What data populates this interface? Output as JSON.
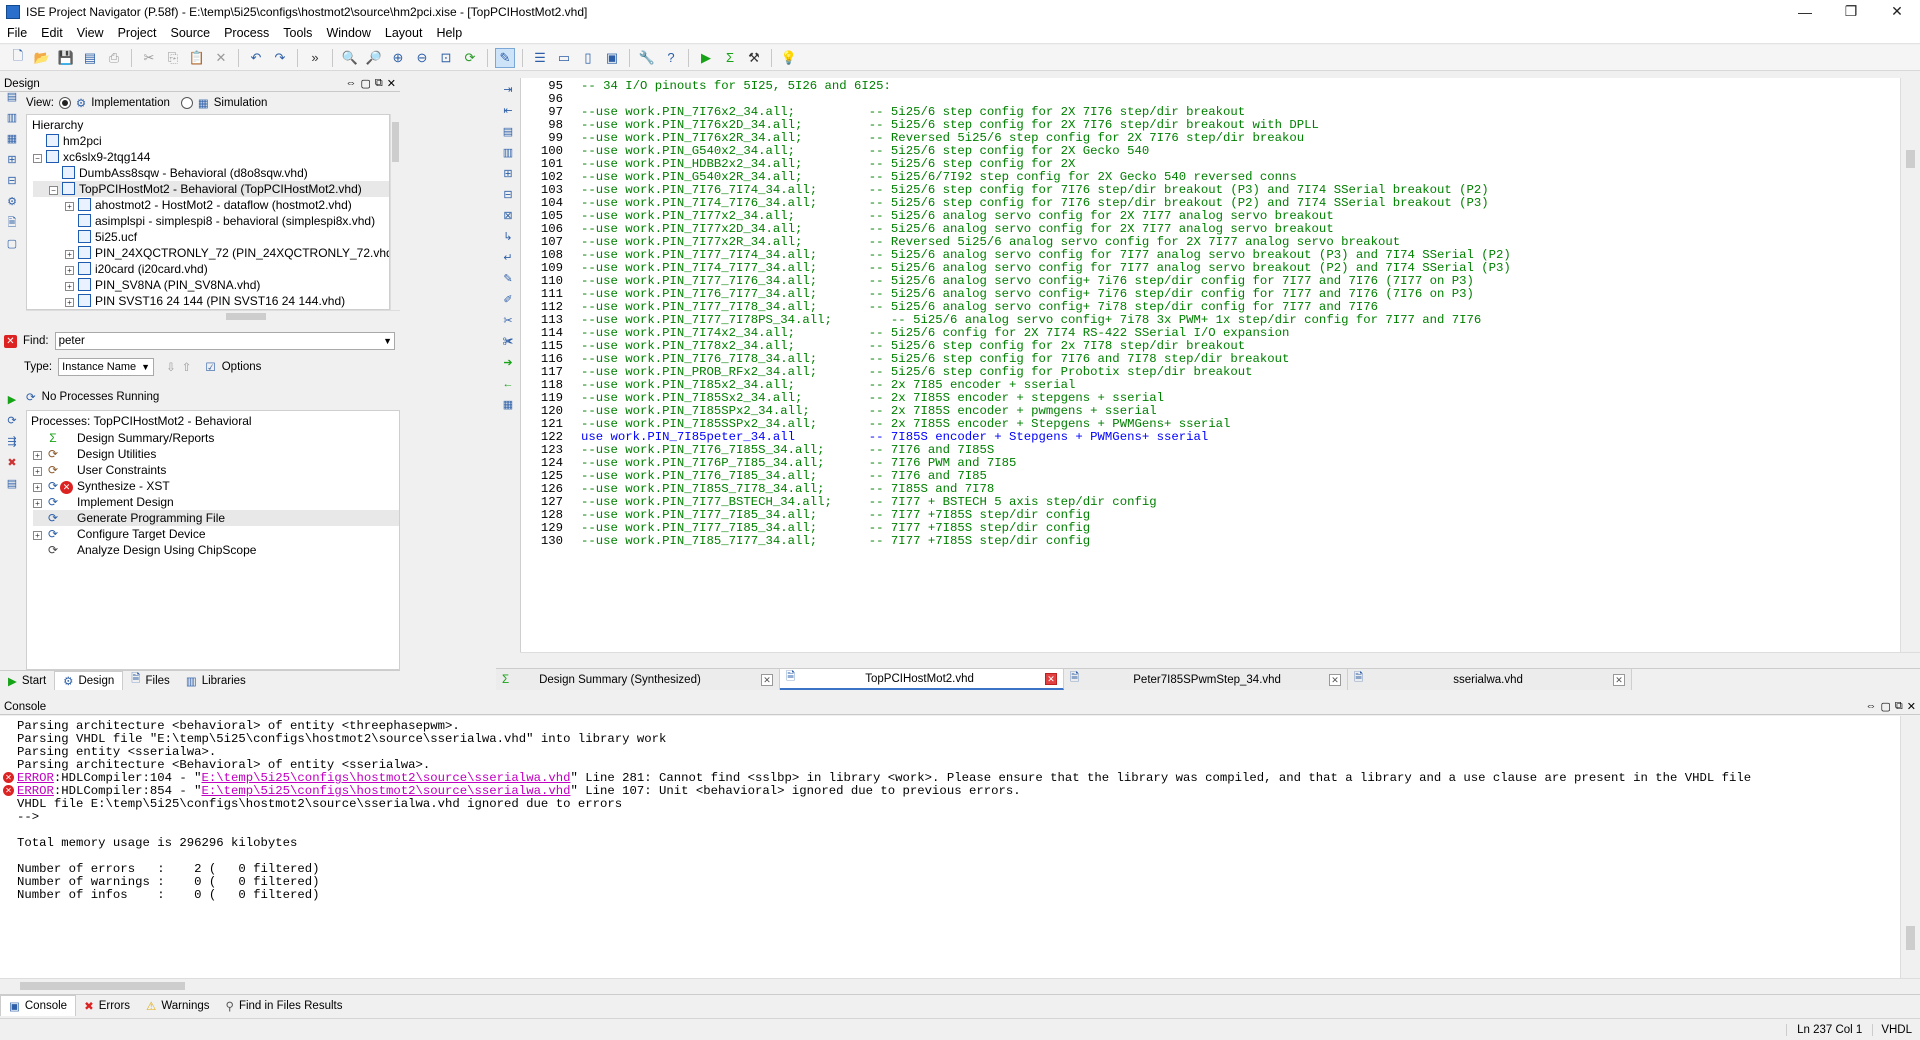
{
  "window": {
    "title": "ISE Project Navigator (P.58f) - E:\\temp\\5i25\\configs\\hostmot2\\source\\hm2pci.xise - [TopPCIHostMot2.vhd]"
  },
  "menu": [
    "File",
    "Edit",
    "View",
    "Project",
    "Source",
    "Process",
    "Tools",
    "Window",
    "Layout",
    "Help"
  ],
  "design_panel": {
    "title": "Design",
    "view_label": "View:",
    "radio_impl": "Implementation",
    "radio_sim": "Simulation",
    "hierarchy_label": "Hierarchy",
    "tree": [
      {
        "label": "hm2pci",
        "indent": 0,
        "exp": ""
      },
      {
        "label": "xc6slx9-2tqg144",
        "indent": 0,
        "exp": "−"
      },
      {
        "label": "DumbAss8sqw - Behavioral (d8o8sqw.vhd)",
        "indent": 1,
        "exp": ""
      },
      {
        "label": "TopPCIHostMot2 - Behavioral (TopPCIHostMot2.vhd)",
        "indent": 1,
        "exp": "−"
      },
      {
        "label": "ahostmot2 - HostMot2 - dataflow (hostmot2.vhd)",
        "indent": 2,
        "exp": "+"
      },
      {
        "label": "asimplspi - simplespi8 - behavioral (simplespi8x.vhd)",
        "indent": 2,
        "exp": ""
      },
      {
        "label": "5i25.ucf",
        "indent": 2,
        "exp": ""
      },
      {
        "label": "PIN_24XQCTRONLY_72 (PIN_24XQCTRONLY_72.vhd)",
        "indent": 2,
        "exp": "+"
      },
      {
        "label": "i20card (i20card.vhd)",
        "indent": 2,
        "exp": "+"
      },
      {
        "label": "PIN_SV8NA (PIN_SV8NA.vhd)",
        "indent": 2,
        "exp": "+"
      },
      {
        "label": "PIN SVST16 24 144 (PIN SVST16 24 144.vhd)",
        "indent": 2,
        "exp": "+"
      }
    ],
    "find_label": "Find:",
    "find_value": "peter",
    "type_label": "Type:",
    "type_value": "Instance Name",
    "options_label": "Options"
  },
  "processes": {
    "status": "No Processes Running",
    "header": "Processes: TopPCIHostMot2 - Behavioral",
    "items": [
      {
        "label": "Design Summary/Reports",
        "exp": ""
      },
      {
        "label": "Design Utilities",
        "exp": "+"
      },
      {
        "label": "User Constraints",
        "exp": "+"
      },
      {
        "label": "Synthesize - XST",
        "exp": "+"
      },
      {
        "label": "Implement Design",
        "exp": "+"
      },
      {
        "label": "Generate Programming File",
        "exp": ""
      },
      {
        "label": "Configure Target Device",
        "exp": "+"
      },
      {
        "label": "Analyze Design Using ChipScope",
        "exp": ""
      }
    ]
  },
  "left_tabs": [
    "Start",
    "Design",
    "Files",
    "Libraries"
  ],
  "editor": {
    "lines": [
      {
        "n": "95",
        "t": "-- 34 I/O pinouts for 5I25, 5I26 and 6I25:"
      },
      {
        "n": "96",
        "t": ""
      },
      {
        "n": "97",
        "t": "--use work.PIN_7I76x2_34.all;          -- 5i25/6 step config for 2X 7I76 step/dir breakout"
      },
      {
        "n": "98",
        "t": "--use work.PIN_7I76x2D_34.all;         -- 5i25/6 step config for 2X 7I76 step/dir breakout with DPLL"
      },
      {
        "n": "99",
        "t": "--use work.PIN_7I76x2R_34.all;         -- Reversed 5i25/6 step config for 2X 7I76 step/dir breakou"
      },
      {
        "n": "100",
        "t": "--use work.PIN_G540x2_34.all;          -- 5i25/6 step config for 2X Gecko 540"
      },
      {
        "n": "101",
        "t": "--use work.PIN_HDBB2x2_34.all;         -- 5i25/6 step config for 2X"
      },
      {
        "n": "102",
        "t": "--use work.PIN_G540x2R_34.all;         -- 5i25/6/7I92 step config for 2X Gecko 540 reversed conns"
      },
      {
        "n": "103",
        "t": "--use work.PIN_7I76_7I74_34.all;       -- 5i25/6 step config for 7I76 step/dir breakout (P3) and 7I74 SSerial breakout (P2)"
      },
      {
        "n": "104",
        "t": "--use work.PIN_7I74_7I76_34.all;       -- 5i25/6 step config for 7I76 step/dir breakout (P2) and 7I74 SSerial breakout (P3)"
      },
      {
        "n": "105",
        "t": "--use work.PIN_7I77x2_34.all;          -- 5i25/6 analog servo config for 2X 7I77 analog servo breakout"
      },
      {
        "n": "106",
        "t": "--use work.PIN_7I77x2D_34.all;         -- 5i25/6 analog servo config for 2X 7I77 analog servo breakout"
      },
      {
        "n": "107",
        "t": "--use work.PIN_7I77x2R_34.all;         -- Reversed 5i25/6 analog servo config for 2X 7I77 analog servo breakout"
      },
      {
        "n": "108",
        "t": "--use work.PIN_7I77_7I74_34.all;       -- 5i25/6 analog servo config for 7I77 analog servo breakout (P3) and 7I74 SSerial (P2)"
      },
      {
        "n": "109",
        "t": "--use work.PIN_7I74_7I77_34.all;       -- 5i25/6 analog servo config for 7I77 analog servo breakout (P2) and 7I74 SSerial (P3)"
      },
      {
        "n": "110",
        "t": "--use work.PIN_7I77_7I76_34.all;       -- 5i25/6 analog servo config+ 7i76 step/dir config for 7I77 and 7I76 (7I77 on P3)"
      },
      {
        "n": "111",
        "t": "--use work.PIN_7I76_7I77_34.all;       -- 5i25/6 analog servo config+ 7i76 step/dir config for 7I77 and 7I76 (7I76 on P3)"
      },
      {
        "n": "112",
        "t": "--use work.PIN_7I77_7I78_34.all;       -- 5i25/6 analog servo config+ 7i78 step/dir config for 7I77 and 7I76"
      },
      {
        "n": "113",
        "t": "--use work.PIN_7I77_7I78PS_34.all;        -- 5i25/6 analog servo config+ 7i78 3x PWM+ 1x step/dir config for 7I77 and 7I76"
      },
      {
        "n": "114",
        "t": "--use work.PIN_7I74x2_34.all;          -- 5i25/6 config for 2X 7I74 RS-422 SSerial I/O expansion"
      },
      {
        "n": "115",
        "t": "--use work.PIN_7I78x2_34.all;          -- 5i25/6 step config for 2x 7I78 step/dir breakout"
      },
      {
        "n": "116",
        "t": "--use work.PIN_7I76_7I78_34.all;       -- 5i25/6 step config for 7I76 and 7I78 step/dir breakout"
      },
      {
        "n": "117",
        "t": "--use work.PIN_PROB_RFx2_34.all;       -- 5i25/6 step config for Probotix step/dir breakout"
      },
      {
        "n": "118",
        "t": "--use work.PIN_7I85x2_34.all;          -- 2x 7I85 encoder + sserial"
      },
      {
        "n": "119",
        "t": "--use work.PIN_7I85Sx2_34.all;         -- 2x 7I85S encoder + stepgens + sserial"
      },
      {
        "n": "120",
        "t": "--use work.PIN_7I85SPx2_34.all;        -- 2x 7I85S encoder + pwmgens + sserial"
      },
      {
        "n": "121",
        "t": "--use work.PIN_7I85SSPx2_34.all;       -- 2x 7I85S encoder + Stepgens + PWMGens+ sserial"
      },
      {
        "n": "122",
        "t": "use work.PIN_7I85peter_34.all          -- 7I85S encoder + Stepgens + PWMGens+ sserial",
        "kw": true
      },
      {
        "n": "123",
        "t": "--use work.PIN_7I76_7I85S_34.all;      -- 7I76 and 7I85S"
      },
      {
        "n": "124",
        "t": "--use work.PIN_7I76P_7I85_34.all;      -- 7I76 PWM and 7I85"
      },
      {
        "n": "125",
        "t": "--use work.PIN_7I76_7I85_34.all;       -- 7I76 and 7I85"
      },
      {
        "n": "126",
        "t": "--use work.PIN_7I85S_7I78_34.all;      -- 7I85S and 7I78"
      },
      {
        "n": "127",
        "t": "--use work.PIN_7I77_BSTECH_34.all;     -- 7I77 + BSTECH 5 axis step/dir config"
      },
      {
        "n": "128",
        "t": "--use work.PIN_7I77_7I85_34.all;       -- 7I77 +7I85S step/dir config"
      },
      {
        "n": "129",
        "t": "--use work.PIN_7I77_7I85_34.all;       -- 7I77 +7I85S step/dir config"
      },
      {
        "n": "130",
        "t": "--use work.PIN_7I85_7I77_34.all;       -- 7I77 +7I85S step/dir config"
      }
    ]
  },
  "editor_tabs": [
    {
      "label": "Design Summary (Synthesized)",
      "close": "plain"
    },
    {
      "label": "TopPCIHostMot2.vhd",
      "close": "red"
    },
    {
      "label": "Peter7I85SPwmStep_34.vhd",
      "close": "plain"
    },
    {
      "label": "sserialwa.vhd",
      "close": "plain"
    }
  ],
  "console": {
    "title": "Console",
    "lines": [
      {
        "t": "Parsing architecture <behavioral> of entity <threephasepwm>."
      },
      {
        "t": "Parsing VHDL file \"E:\\temp\\5i25\\configs\\hostmot2\\source\\sserialwa.vhd\" into library work"
      },
      {
        "t": "Parsing entity <sserialwa>."
      },
      {
        "t": "Parsing architecture <Behavioral> of entity <sserialwa>."
      },
      {
        "err": true,
        "pre": "ERROR",
        "mid": ":HDLCompiler:104 - \"",
        "link": "E:\\temp\\5i25\\configs\\hostmot2\\source\\sserialwa.vhd",
        "post": "\" Line 281: Cannot find <sslbp> in library <work>. Please ensure that the library was compiled, and that a library and a use clause are present in the VHDL file"
      },
      {
        "err": true,
        "pre": "ERROR",
        "mid": ":HDLCompiler:854 - \"",
        "link": "E:\\temp\\5i25\\configs\\hostmot2\\source\\sserialwa.vhd",
        "post": "\" Line 107: Unit <behavioral> ignored due to previous errors."
      },
      {
        "t": "VHDL file E:\\temp\\5i25\\configs\\hostmot2\\source\\sserialwa.vhd ignored due to errors"
      },
      {
        "t": "-->"
      },
      {
        "t": ""
      },
      {
        "t": "Total memory usage is 296296 kilobytes"
      },
      {
        "t": ""
      },
      {
        "t": "Number of errors   :    2 (   0 filtered)"
      },
      {
        "t": "Number of warnings :    0 (   0 filtered)"
      },
      {
        "t": "Number of infos    :    0 (   0 filtered)"
      }
    ]
  },
  "bottom_tabs": [
    "Console",
    "Errors",
    "Warnings",
    "Find in Files Results"
  ],
  "statusbar": {
    "position": "Ln 237 Col 1",
    "language": "VHDL"
  },
  "colors": {
    "comment": "#008000",
    "keyword": "#0000ff",
    "error_link": "#c000c0"
  }
}
